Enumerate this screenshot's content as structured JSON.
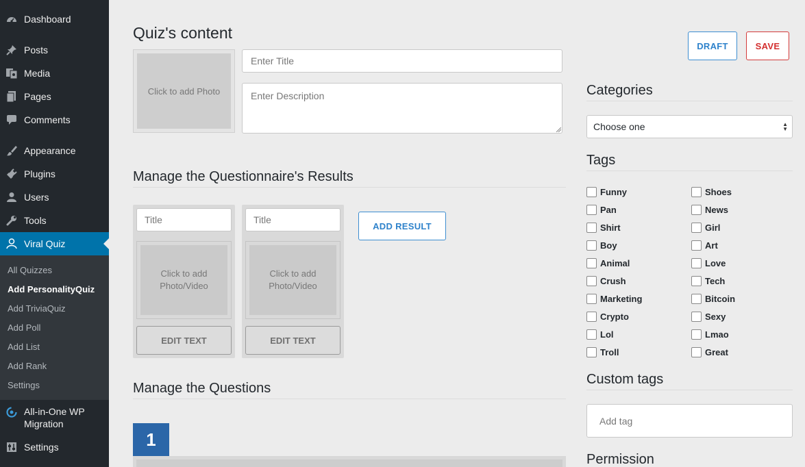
{
  "sidebar": {
    "items": [
      {
        "label": "Dashboard",
        "icon": "dashboard-icon"
      },
      {
        "label": "Posts",
        "icon": "pin-icon"
      },
      {
        "label": "Media",
        "icon": "media-icon"
      },
      {
        "label": "Pages",
        "icon": "pages-icon"
      },
      {
        "label": "Comments",
        "icon": "comment-icon"
      },
      {
        "label": "Appearance",
        "icon": "brush-icon"
      },
      {
        "label": "Plugins",
        "icon": "plug-icon"
      },
      {
        "label": "Users",
        "icon": "user-icon"
      },
      {
        "label": "Tools",
        "icon": "wrench-icon"
      },
      {
        "label": "Viral Quiz",
        "icon": "person-icon"
      },
      {
        "label": "All-in-One WP Migration",
        "label_line1": "All-in-One WP",
        "label_line2": "Migration",
        "icon": "migration-icon"
      },
      {
        "label": "Settings",
        "icon": "settings-icon"
      }
    ],
    "submenu": [
      {
        "label": "All Quizzes"
      },
      {
        "label": "Add PersonalityQuiz"
      },
      {
        "label": "Add TriviaQuiz"
      },
      {
        "label": "Add Poll"
      },
      {
        "label": "Add List"
      },
      {
        "label": "Add Rank"
      },
      {
        "label": "Settings"
      }
    ],
    "active_color": "#0073aa"
  },
  "main": {
    "title": "Quiz's content",
    "photo_placeholder": "Click to add Photo",
    "title_placeholder": "Enter Title",
    "description_placeholder": "Enter Description",
    "results_heading": "Manage the Questionnaire's Results",
    "results": [
      {
        "title_placeholder": "Title",
        "media_line1": "Click to add",
        "media_line2": "Photo/Video",
        "edit_label": "EDIT TEXT"
      },
      {
        "title_placeholder": "Title",
        "media_line1": "Click to add",
        "media_line2": "Photo/Video",
        "edit_label": "EDIT TEXT"
      }
    ],
    "add_result_label": "ADD RESULT",
    "questions_heading": "Manage the Questions",
    "question_number": "1"
  },
  "right": {
    "draft_label": "DRAFT",
    "save_label": "SAVE",
    "categories_heading": "Categories",
    "categories_selected": "Choose one",
    "tags_heading": "Tags",
    "tags_left": [
      "Funny",
      "Pan",
      "Shirt",
      "Boy",
      "Animal",
      "Crush",
      "Marketing",
      "Crypto",
      "Lol",
      "Troll"
    ],
    "tags_right": [
      "Shoes",
      "News",
      "Girl",
      "Art",
      "Love",
      "Tech",
      "Bitcoin",
      "Sexy",
      "Lmao",
      "Great"
    ],
    "custom_tags_heading": "Custom tags",
    "add_tag_placeholder": "Add tag",
    "permission_heading": "Permission"
  },
  "colors": {
    "sidebar_bg": "#23282d",
    "accent_blue": "#2e82cb",
    "save_red": "#d32f2f",
    "question_badge": "#2b66a8"
  }
}
